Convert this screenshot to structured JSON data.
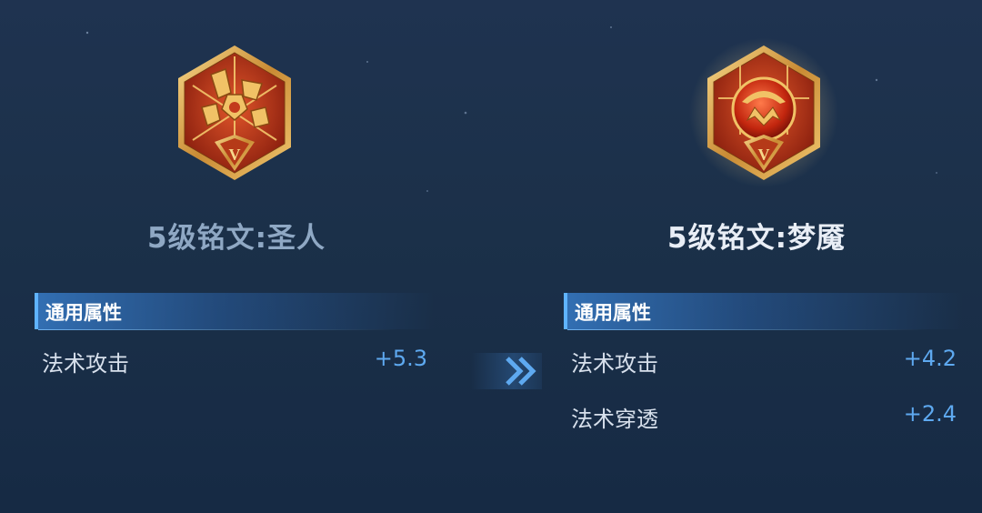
{
  "from_rune": {
    "title": "5级铭文:圣人",
    "emblem_icon": "saint-rune-icon",
    "tier_numeral": "V",
    "section_title": "通用属性",
    "stats": [
      {
        "name": "法术攻击",
        "value": "+5.3"
      }
    ]
  },
  "to_rune": {
    "title": "5级铭文:梦魇",
    "emblem_icon": "nightmare-rune-icon",
    "tier_numeral": "V",
    "section_title": "通用属性",
    "stats": [
      {
        "name": "法术攻击",
        "value": "+4.2"
      },
      {
        "name": "法术穿透",
        "value": "+2.4"
      }
    ]
  },
  "arrow_icon": "double-chevron-right-icon",
  "colors": {
    "background": "#1b3049",
    "accent_blue": "#5ea9f0",
    "title_dim": "#8fa8c4",
    "title_bright": "#e9eef6",
    "emblem_red": "#c23a1c",
    "emblem_gold": "#e6b25a"
  }
}
